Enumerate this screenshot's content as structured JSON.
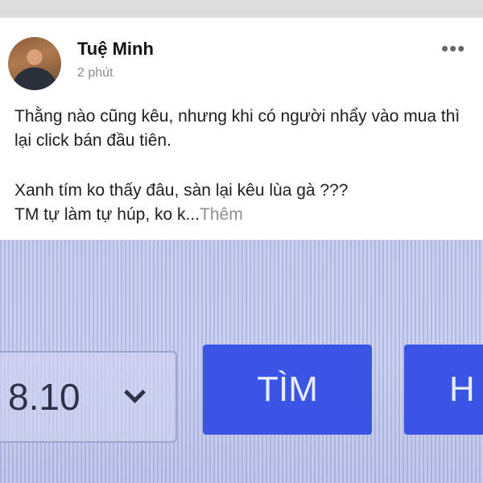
{
  "post": {
    "author": "Tuệ Minh",
    "time": "2 phút",
    "more_icon": "more-horizontal-icon",
    "line1": "Thằng nào cũng kêu, nhưng khi có người nhẩy vào mua thì lại click bán đầu tiên.",
    "line2": "Xanh tím ko thấy đâu, sàn lại kêu lùa gà ???",
    "line3": "TM tự làm tự húp, ko k...",
    "see_more": "Thêm"
  },
  "photo": {
    "select_value": "8.10",
    "search_button": "TÌM",
    "second_button": "H"
  },
  "colors": {
    "button_blue": "#3a55e6",
    "photo_bg": "#c7ccef",
    "secondary_text": "#8a8d91"
  }
}
